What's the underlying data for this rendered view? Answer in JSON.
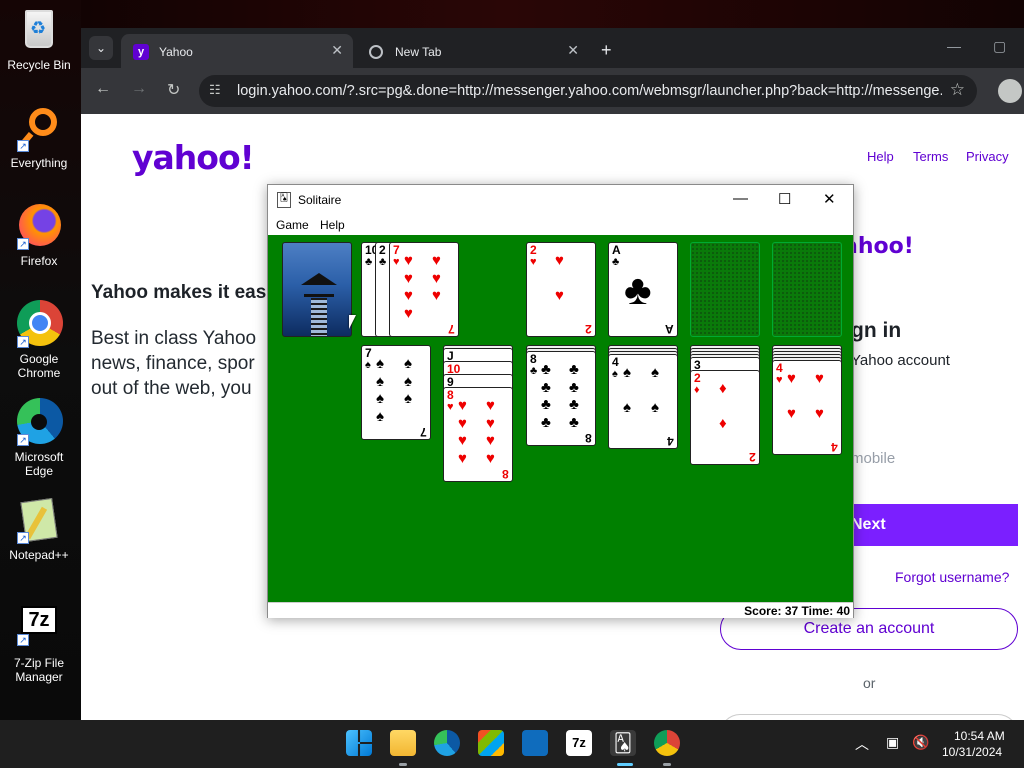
{
  "desktop": {
    "icons": [
      {
        "label": "Recycle Bin",
        "icon": "recycle-bin-icon"
      },
      {
        "label": "Everything",
        "icon": "everything-search-icon"
      },
      {
        "label": "Firefox",
        "icon": "firefox-icon"
      },
      {
        "label": "Google Chrome",
        "icon": "chrome-icon"
      },
      {
        "label": "Microsoft Edge",
        "icon": "edge-icon"
      },
      {
        "label": "Notepad++",
        "icon": "notepadpp-icon"
      },
      {
        "label": "7-Zip File Manager",
        "icon": "7zip-icon"
      }
    ]
  },
  "browser": {
    "tabs": [
      {
        "title": "Yahoo",
        "active": true
      },
      {
        "title": "New Tab",
        "active": false
      }
    ],
    "url": "login.yahoo.com/?.src=pg&.done=http://messenger.yahoo.com/webmsgr/launcher.php?back=http://messenge..."
  },
  "yahoo": {
    "logo": "yahoo!",
    "links": [
      "Help",
      "Terms",
      "Privacy"
    ],
    "tagline": "Yahoo makes it eas",
    "desc_lines": [
      "Best in class Yahoo",
      "news, finance, spor",
      "out of the web, you"
    ],
    "logo_right": "ahoo!",
    "signin_title": "gn in",
    "signin_sub": "Yahoo account",
    "mobile_placeholder": "mobile",
    "next": "Next",
    "forgot": "Forgot username?",
    "create": "Create an account",
    "or": "or"
  },
  "solitaire": {
    "title": "Solitaire",
    "menu": [
      "Game",
      "Help"
    ],
    "status": "Score: 37 Time: 40",
    "waste": [
      {
        "rank": "10",
        "suit": "♣",
        "color": "black"
      },
      {
        "rank": "2",
        "suit": "♣",
        "color": "black"
      },
      {
        "rank": "7",
        "suit": "♥",
        "color": "red"
      }
    ],
    "foundations": [
      {
        "rank": "2",
        "suit": "♥",
        "color": "red"
      },
      {
        "rank": "A",
        "suit": "♣",
        "color": "black"
      },
      null,
      null
    ],
    "tableau": [
      {
        "face_down": 0,
        "face_up": [
          {
            "rank": "7",
            "suit": "♠",
            "color": "black"
          }
        ]
      },
      {
        "face_down": 1,
        "face_up": [
          {
            "rank": "J",
            "suit": "",
            "color": "black"
          },
          {
            "rank": "10",
            "suit": "♥",
            "color": "red"
          },
          {
            "rank": "9",
            "suit": "♠",
            "color": "black"
          },
          {
            "rank": "8",
            "suit": "♥",
            "color": "red"
          }
        ]
      },
      {
        "face_down": 2,
        "face_up": [
          {
            "rank": "8",
            "suit": "♣",
            "color": "black"
          }
        ]
      },
      {
        "face_down": 3,
        "face_up": [
          {
            "rank": "4",
            "suit": "♠",
            "color": "black"
          }
        ]
      },
      {
        "face_down": 4,
        "face_up": [
          {
            "rank": "3",
            "suit": "♠",
            "color": "black"
          },
          {
            "rank": "2",
            "suit": "♦",
            "color": "red"
          }
        ]
      },
      {
        "face_down": 5,
        "face_up": [
          {
            "rank": "4",
            "suit": "♥",
            "color": "red"
          }
        ]
      }
    ]
  },
  "taskbar": {
    "apps": [
      "start-icon",
      "file-explorer-icon",
      "edge-icon",
      "store-icon",
      "outlook-icon",
      "7zip-icon",
      "solitaire-icon",
      "chrome-icon"
    ],
    "time": "10:54 AM",
    "date": "10/31/2024"
  }
}
